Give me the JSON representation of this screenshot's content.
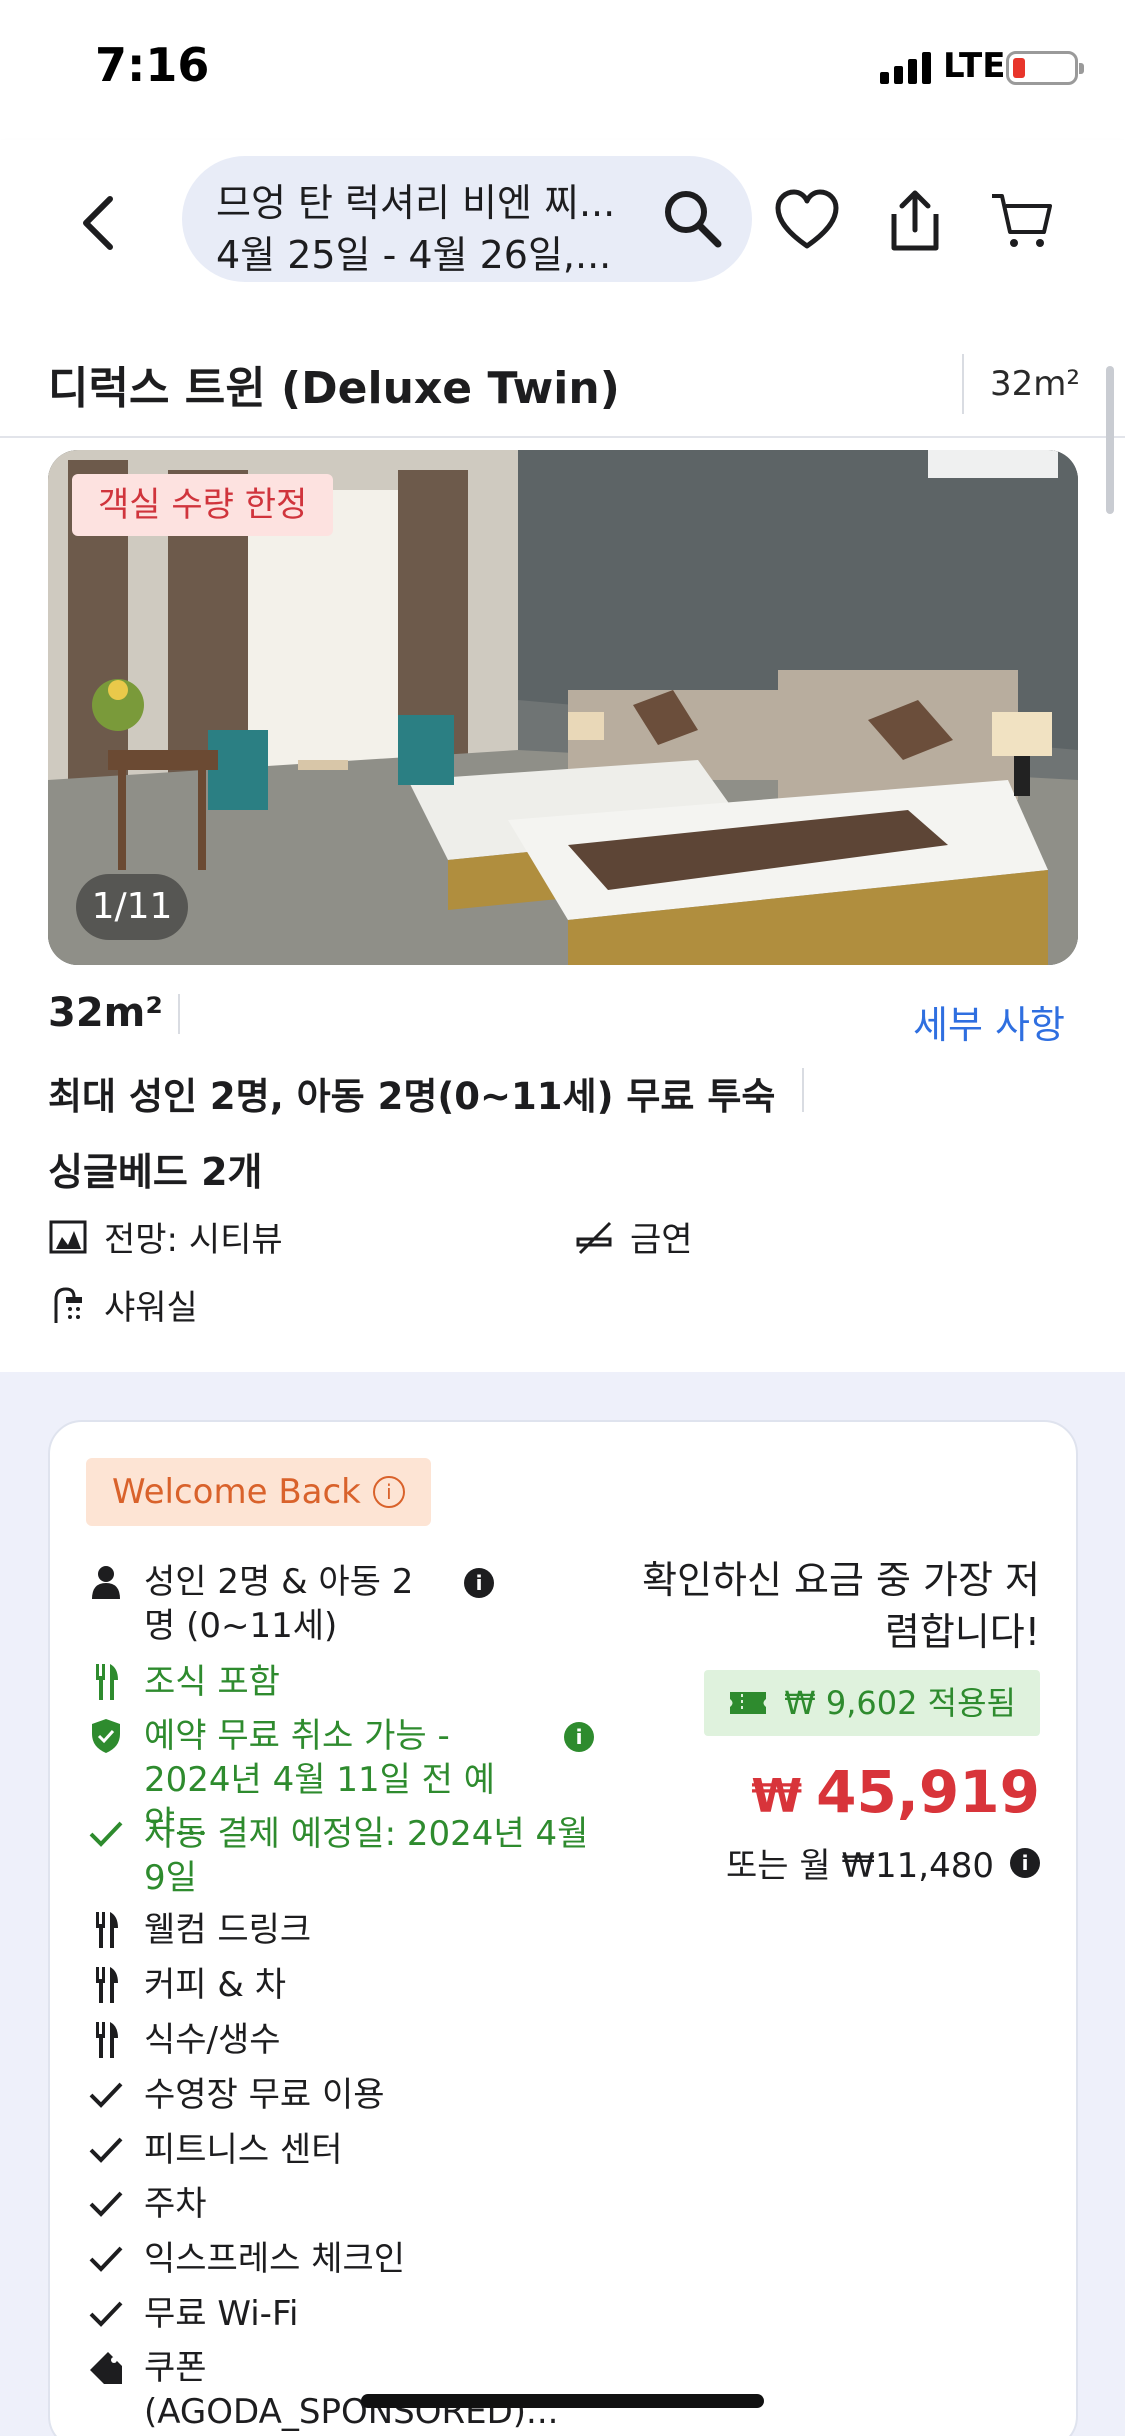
{
  "status_bar": {
    "time": "7:16",
    "network": "LTE",
    "battery_level": 0.12
  },
  "header": {
    "search_title": "므엉 탄 럭셔리 비엔 찌...",
    "search_dates": "4월 25일 - 4월 26일,..."
  },
  "room": {
    "title": "디럭스 트윈 (Deluxe Twin)",
    "size": "32m²",
    "limited_badge": "객실 수량 한정",
    "photo_counter": "1/11",
    "size_detail": "32m²",
    "details_link": "세부 사항",
    "occupancy": "최대 성인 2명, 아동 2명(0~11세) 무료 투숙",
    "beds": "싱글베드 2개",
    "amenities": {
      "view": "전망: 시티뷰",
      "smoking": "금연",
      "shower": "샤워실"
    }
  },
  "offer": {
    "welcome_label": "Welcome Back",
    "features": {
      "guests": "성인 2명 & 아동 2명 (0~11세)",
      "breakfast": "조식 포함",
      "cancellation": "예약 무료 취소 가능 - 2024년 4월 11일 전 예약...",
      "auto_payment": "자동 결제 예정일: 2024년 4월 9일",
      "welcome_drink": "웰컴 드링크",
      "coffee_tea": "커피 & 차",
      "water": "식수/생수",
      "pool": "수영장 무료 이용",
      "fitness": "피트니스 센터",
      "parking": "주차",
      "express_checkin": "익스프레스 체크인",
      "wifi": "무료 Wi-Fi",
      "coupon": "쿠폰 (AGODA_SPONSORED)..."
    },
    "lowest_msg": "확인하신 요금 중 가장 저렴합니다!",
    "coupon_applied": "₩ 9,602 적용됨",
    "currency_symbol": "₩",
    "price": "45,919",
    "monthly": "또는 월 ₩11,480"
  },
  "colors": {
    "accent_blue": "#2f6fe0",
    "price_red": "#d8343a",
    "green": "#2e8b2e",
    "welcome_orange": "#d9622b"
  }
}
